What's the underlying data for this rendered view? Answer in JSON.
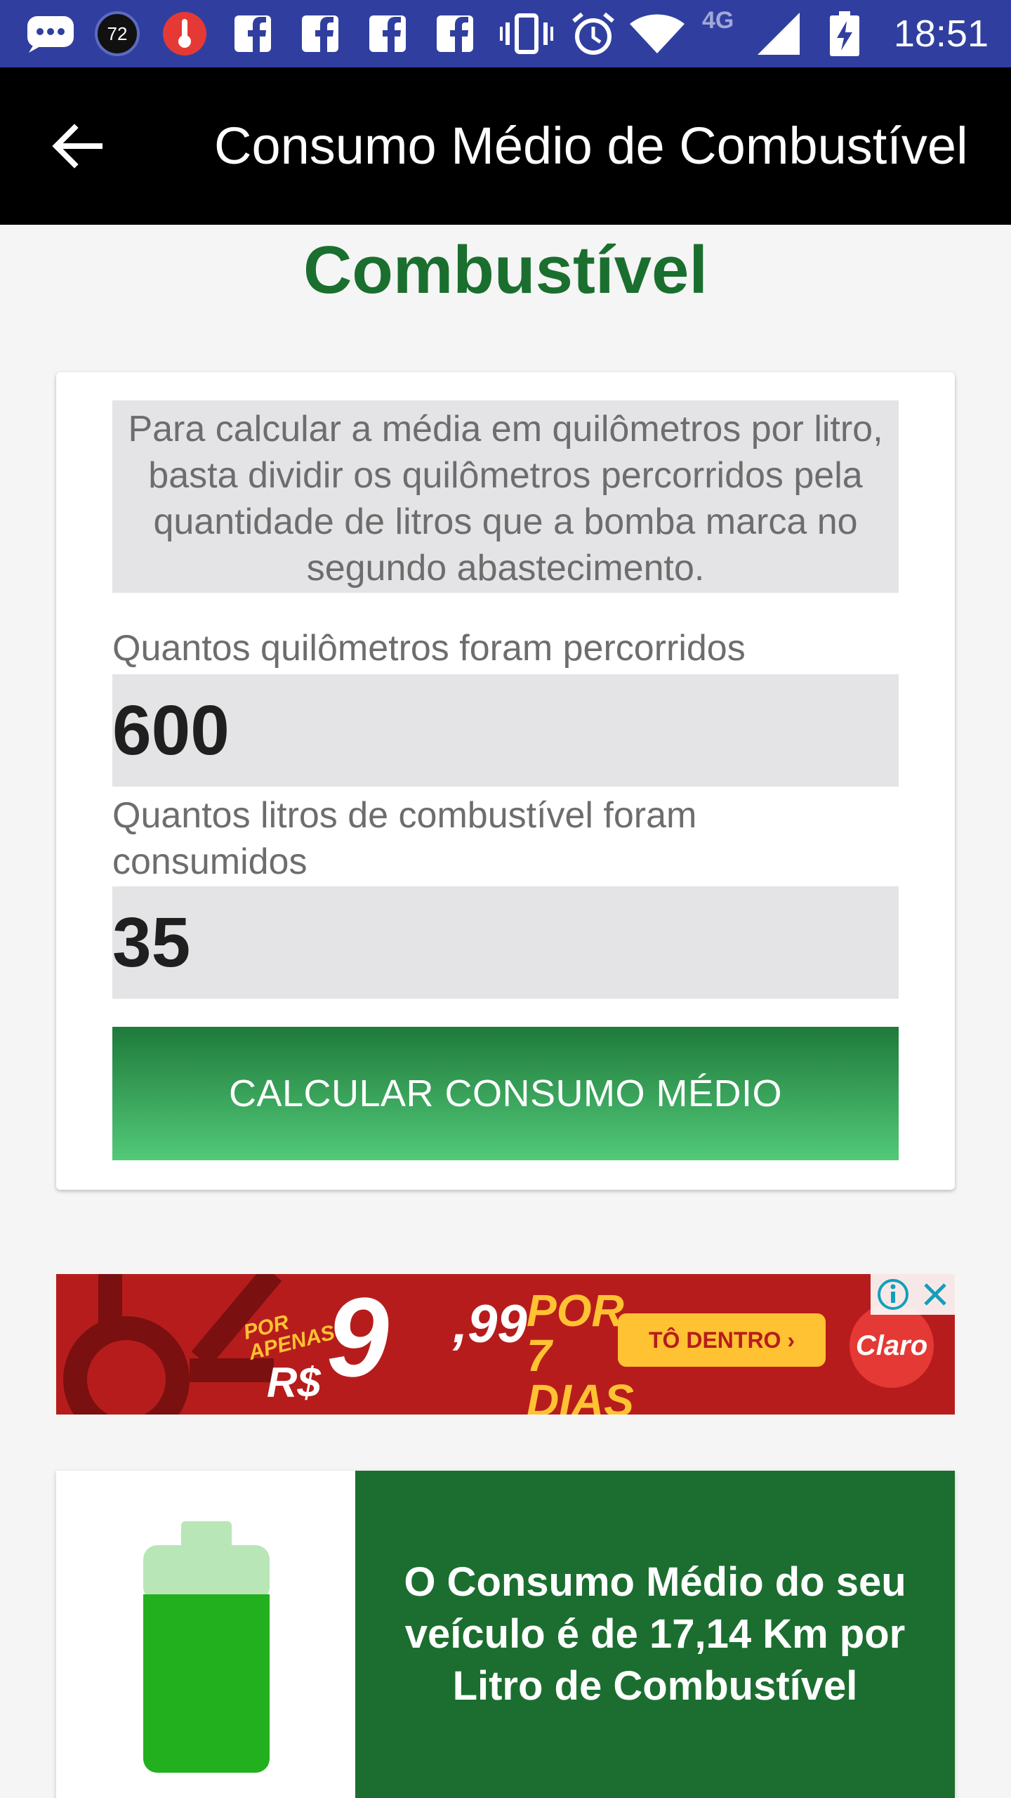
{
  "status_bar": {
    "time": "18:51",
    "notification_count": "72",
    "network": "4G",
    "icons": [
      "messages-icon",
      "count-badge-icon",
      "thermometer-icon",
      "facebook-icon",
      "facebook-icon",
      "facebook-icon",
      "facebook-icon",
      "vibrate-icon",
      "alarm-icon",
      "wifi-icon",
      "signal-icon",
      "battery-charging-icon"
    ]
  },
  "toolbar": {
    "back_icon": "arrow-left-icon",
    "title": "Consumo Médio de Combustível"
  },
  "heading": "Combustível",
  "calculator": {
    "info": "Para calcular a média em quilômetros por litro, basta dividir os quilômetros percorridos pela quantidade de litros que a bomba marca no segundo abastecimento.",
    "km_label": "Quantos quilômetros foram percorridos",
    "km_value": "600",
    "liters_label": "Quantos litros de combustível foram consumidos",
    "liters_value": "35",
    "button_label": "CALCULAR CONSUMO MÉDIO"
  },
  "ad": {
    "por_apenas": "POR APENAS",
    "currency": "R$",
    "price_int": "9",
    "price_cents": ",99",
    "period": "POR 7 DIAS",
    "cta": "TÔ DENTRO ›",
    "brand": "Claro",
    "info_icon": "info-icon",
    "close_icon": "close-icon"
  },
  "result": {
    "icon": "battery-icon",
    "text": "O Consumo Médio do seu veículo é de 17,14 Km por Litro de Combustível"
  },
  "colors": {
    "status_bar": "#303f9f",
    "toolbar": "#000000",
    "heading": "#1a6f2e",
    "button_top": "#1f7a3a",
    "button_bottom": "#52c979",
    "result_panel": "#1b6e2f",
    "battery": "#22b01e",
    "battery_light": "#b9e6b7"
  }
}
